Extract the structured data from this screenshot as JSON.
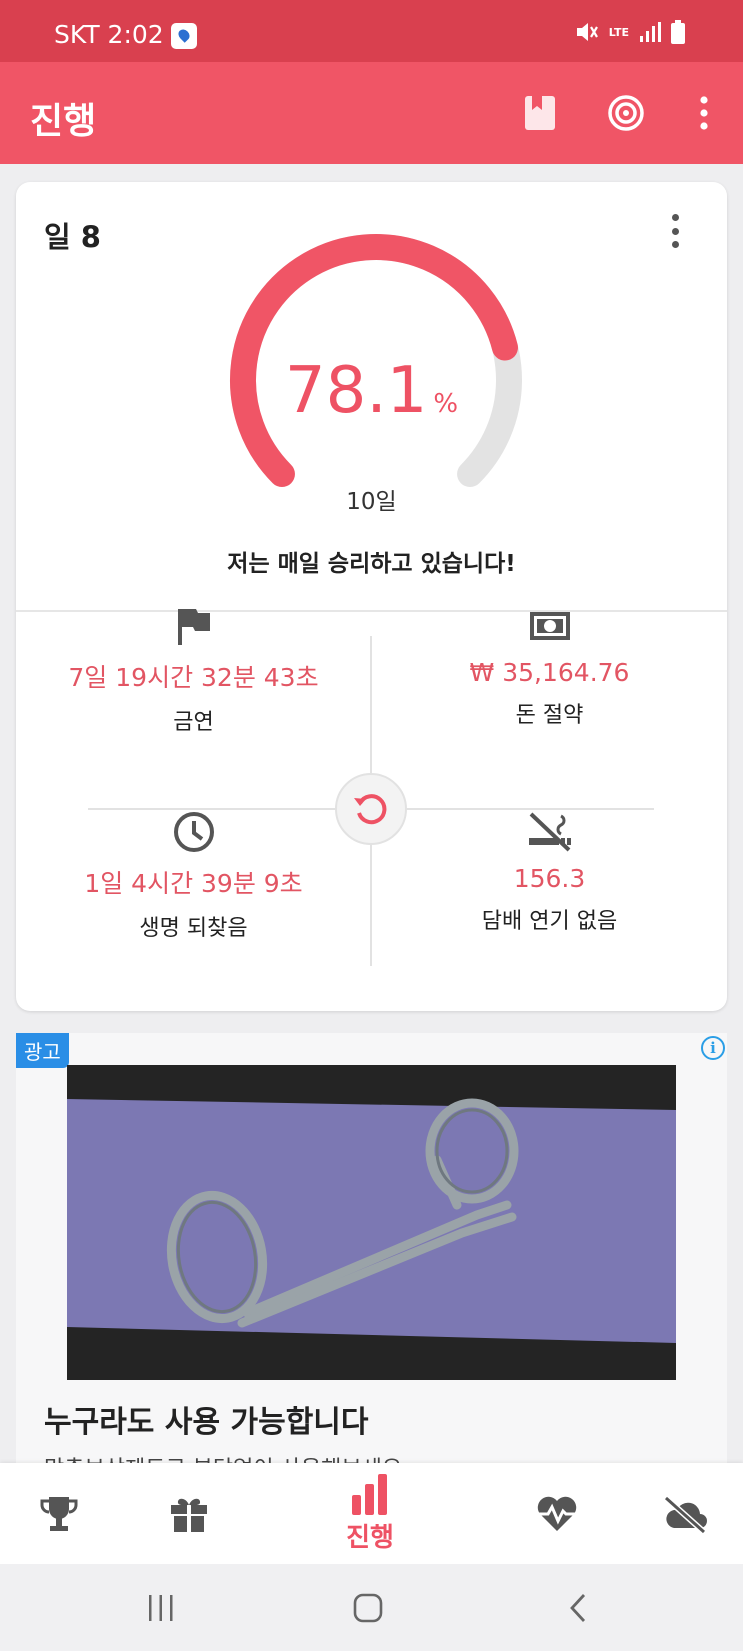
{
  "status_bar": {
    "carrier_time": "SKT 2:02",
    "network": "LTE"
  },
  "app_bar": {
    "title": "진행",
    "actions": [
      "book-icon",
      "target-icon",
      "more-vert-icon"
    ]
  },
  "progress_card": {
    "day_label": "일 8",
    "percent": "78.1",
    "percent_unit": "%",
    "percent_value": 0.781,
    "goal": "10일",
    "motto": "저는 매일 승리하고 있습니다!"
  },
  "stats": {
    "quit_time": {
      "value": "7일 19시간 32분 43초",
      "label": "금연",
      "icon": "flag-icon"
    },
    "money_saved": {
      "value": "₩ 35,164.76",
      "label": "돈 절약",
      "icon": "cash-icon"
    },
    "life_regained": {
      "value": "1일 4시간 39분 9초",
      "label": "생명 되찾음",
      "icon": "clock-icon"
    },
    "cigarettes_avoided": {
      "value": "156.3",
      "label": "담배 연기 없음",
      "icon": "no-smoking-icon"
    }
  },
  "ad": {
    "badge": "광고",
    "headline": "누구라도 사용 가능합니다",
    "subtext": "맞춤보상제도로 부담없이 사용해보세요"
  },
  "bottom_nav": {
    "active_label": "진행"
  },
  "colors": {
    "primary": "#f05566",
    "status_bar": "#d9404f",
    "accent_text": "#e25563",
    "gauge_track": "#e3e3e3"
  }
}
